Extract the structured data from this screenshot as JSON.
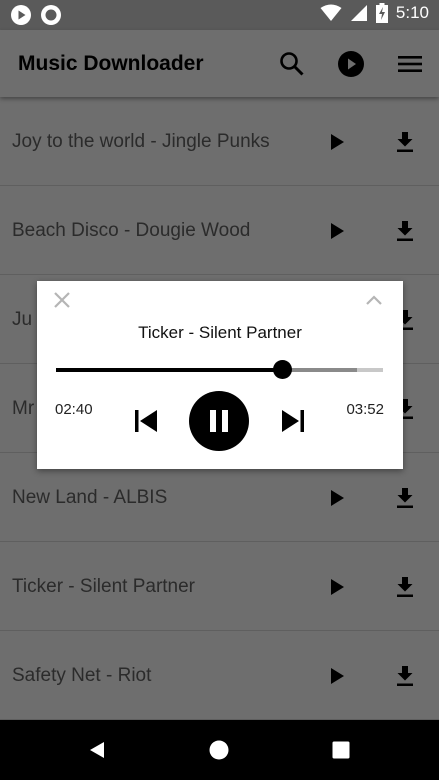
{
  "status_bar": {
    "time": "5:10",
    "left_icons": [
      "play-circle-icon",
      "record-icon"
    ],
    "right_icons": [
      "wifi-icon",
      "signal-icon",
      "battery-charging-icon"
    ]
  },
  "app_bar": {
    "title": "Music Downloader",
    "actions": [
      "search-icon",
      "play-circle-icon",
      "menu-icon"
    ]
  },
  "songs": [
    {
      "title": "Joy to the world - Jingle Punks"
    },
    {
      "title": "Beach Disco - Dougie Wood"
    },
    {
      "title": "Ju"
    },
    {
      "title": "Mr"
    },
    {
      "title": "New Land - ALBIS"
    },
    {
      "title": "Ticker - Silent Partner"
    },
    {
      "title": "Safety Net - Riot"
    }
  ],
  "player": {
    "title": "Ticker - Silent Partner",
    "elapsed": "02:40",
    "total": "03:52",
    "progress_fraction": 0.69,
    "buffered_fraction": 0.92
  },
  "nav_bar": {
    "buttons": [
      "back-icon",
      "home-icon",
      "recents-icon"
    ]
  },
  "colors": {
    "scrim": "#6e6e6e",
    "player_bg": "#ffffff",
    "accent": "#000000"
  }
}
